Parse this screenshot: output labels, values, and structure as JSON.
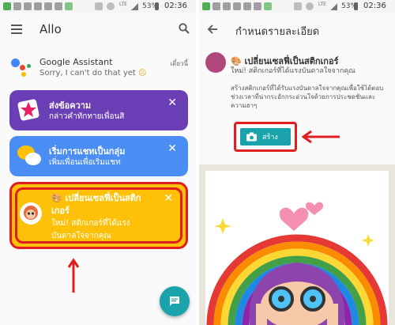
{
  "status_bar": {
    "network": "LTE",
    "battery": "53%",
    "time": "02:36"
  },
  "left": {
    "app_title": "Allo",
    "assistant": {
      "name": "Google Assistant",
      "message": "Sorry, I can't do that yet",
      "time": "เดี๋ยวนี้"
    },
    "cards": [
      {
        "title": "ส่งข้อความ",
        "subtitle": "กล่าวคำทักทายเพื่อนสิ",
        "close": "✕",
        "color": "#6a3fb5"
      },
      {
        "title": "เริ่มการแชทเป็นกลุ่ม",
        "subtitle": "เพิ่มเพื่อนเพื่อเริ่มแชท",
        "close": "✕",
        "color": "#4a8ef5"
      },
      {
        "title_line1": "เปลี่ยนเซลฟี่เป็นสติก",
        "title_line2": "เกอร์",
        "subtitle_line1": "ใหม่! สติกเกอร์ที่ได้แรง",
        "subtitle_line2": "บันดาลใจจากคุณ",
        "close": "✕",
        "color": "#ffc107"
      }
    ],
    "highlight_color": "#e01e1e",
    "fab_icon": "chat-icon"
  },
  "right": {
    "title": "กำหนดรายละเอียด",
    "pack_title": "เปลี่ยนเซลฟี่เป็นสติกเกอร์",
    "pack_desc": "ใหม่! สติกเกอร์ที่ได้แรงบันดาลใจจากคุณ",
    "description": "สร้างสติกเกอร์ที่ได้รับแรงบันดาลใจจากคุณเพื่อใช้ได้ตอบช่วงเวลาที่น่ากระอักกระอ่วนใจด้วยการประชดชันและความฮาๆ",
    "create_button": "สร้าง",
    "accent": "#1ba3ac"
  }
}
